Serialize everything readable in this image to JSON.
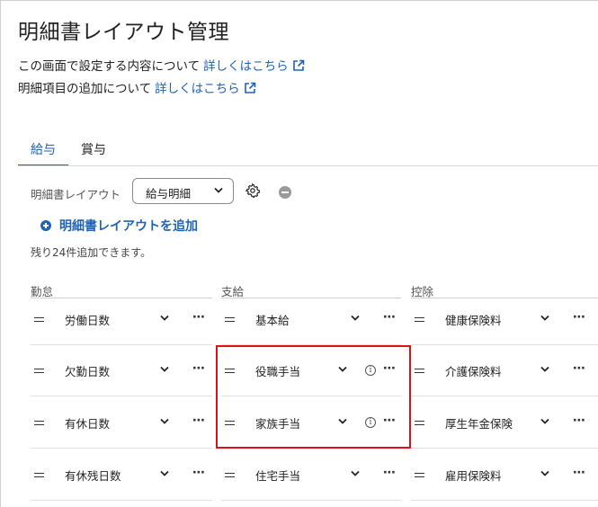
{
  "title": "明細書レイアウト管理",
  "help1": {
    "text": "この画面で設定する内容について",
    "link": "詳しくはこちら"
  },
  "help2": {
    "text": "明細項目の追加について",
    "link": "詳しくはこちら"
  },
  "tabs": [
    {
      "label": "給与",
      "active": true
    },
    {
      "label": "賞与",
      "active": false
    }
  ],
  "layout": {
    "label": "明細書レイアウト",
    "selected": "給与明細"
  },
  "add_label": "明細書レイアウトを追加",
  "remaining": "残り24件追加できます。",
  "columns": [
    {
      "header": "勤怠",
      "items": [
        "労働日数",
        "欠勤日数",
        "有休日数",
        "有休残日数"
      ]
    },
    {
      "header": "支給",
      "items": [
        "基本給",
        "役職手当",
        "家族手当",
        "住宅手当"
      ]
    },
    {
      "header": "控除",
      "items": [
        "健康保険料",
        "介護保険料",
        "厚生年金保険",
        "雇用保険料"
      ]
    }
  ],
  "info_items": [
    "役職手当",
    "家族手当"
  ],
  "colors": {
    "accent": "#1e63b5",
    "highlight": "#d9131b"
  }
}
